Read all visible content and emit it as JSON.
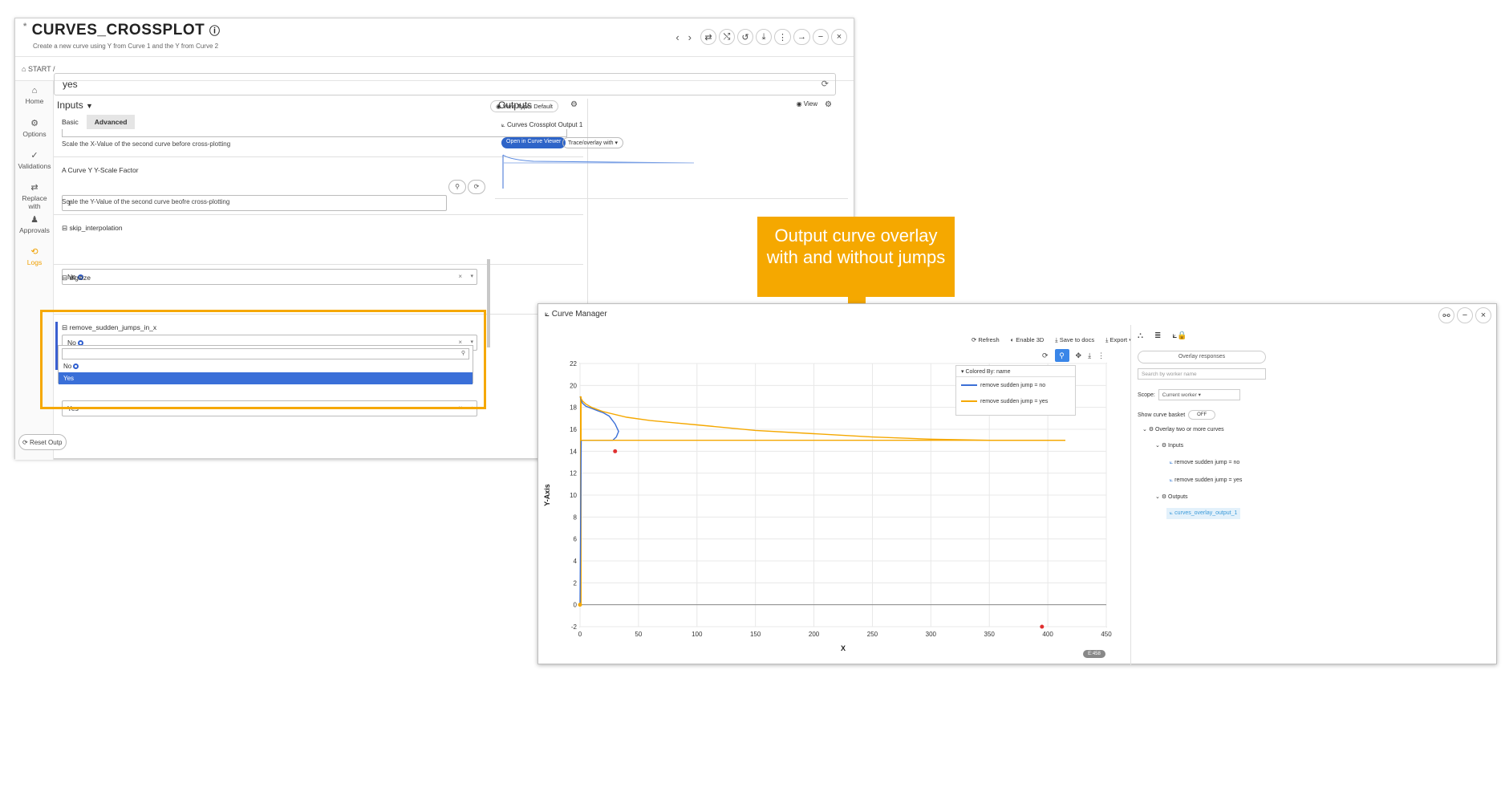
{
  "app": {
    "title": "CURVES_CROSSPLOT",
    "subtitle": "Create a new curve using Y from Curve 1 and the Y from Curve 2",
    "breadcrumb": "START",
    "top_input": "yes"
  },
  "sidebar": {
    "items": [
      {
        "label": "Home",
        "icon": "⌂"
      },
      {
        "label": "Options",
        "icon": "⚙"
      },
      {
        "label": "Validations",
        "icon": "✓"
      },
      {
        "label": "Replace with",
        "icon": "⇄"
      },
      {
        "label": "Approvals",
        "icon": "♟"
      },
      {
        "label": "Logs",
        "icon": "⟲"
      }
    ]
  },
  "inputs": {
    "title": "Inputs",
    "view_type": "View Type: Default",
    "tabs": [
      "Basic",
      "Advanced"
    ],
    "x_scale_help": "Scale the X-Value of the second curve before cross-plotting",
    "y_scale_label": "A  Curve Y Y-Scale Factor",
    "y_scale_value": "1",
    "y_scale_help": "Scale the Y-Value of the second curve beofre cross-plotting",
    "skip_label": "skip_interpolation",
    "skip_value": "No",
    "digitize_label": "digitize",
    "digitize_value": "No",
    "jumps_label": "remove_sudden_jumps_in_x",
    "jumps_value": "Yes",
    "options": [
      "No",
      "Yes"
    ],
    "reset_label": "Reset Outp"
  },
  "outputs": {
    "title": "Outputs",
    "view": "View",
    "item": "Curves Crossplot Output 1",
    "open_btn": "Open in Curve Viewer",
    "trace_btn": "Trace/overlay with ▾"
  },
  "callout": {
    "text": "Output curve overlay with and without jumps"
  },
  "curve_manager": {
    "title": "Curve Manager",
    "toolbar": [
      "Refresh",
      "Enable 3D",
      "Save to docs",
      "Export ▾"
    ],
    "legend_title": "Colored By: name",
    "legend_items": [
      {
        "label": "remove sudden jump = no",
        "color": "#3b6fd6"
      },
      {
        "label": "remove sudden jump = yes",
        "color": "#f5a800"
      }
    ],
    "badge": "E:458"
  },
  "right_panel": {
    "overlay_btn": "Overlay responses",
    "search_placeholder": "Search by worker name",
    "scope_label": "Scope:",
    "scope_value": "Current worker",
    "basket_label": "Show curve basket",
    "basket_toggle": "OFF",
    "tree": {
      "root": "Overlay two or more curves",
      "inputs": "Inputs",
      "input_items": [
        "remove sudden jump = no",
        "remove sudden jump = yes"
      ],
      "outputs": "Outputs",
      "output_item": "curves_overlay_output_1"
    }
  },
  "chart_data": {
    "type": "line",
    "title": "",
    "xlabel": "X",
    "ylabel": "Y-Axis",
    "xlim": [
      0,
      450
    ],
    "ylim": [
      -2,
      22
    ],
    "x_ticks": [
      0,
      50,
      100,
      150,
      200,
      250,
      300,
      350,
      400,
      450
    ],
    "y_ticks": [
      -2,
      0,
      2,
      4,
      6,
      8,
      10,
      12,
      14,
      16,
      18,
      20,
      22
    ],
    "grid": true,
    "series": [
      {
        "name": "remove sudden jump = no",
        "color": "#3b6fd6",
        "x": [
          0,
          2,
          5,
          10,
          15,
          20,
          25,
          30,
          33,
          31,
          28,
          5,
          1,
          0
        ],
        "y": [
          19.0,
          18.4,
          18.1,
          17.9,
          17.7,
          17.5,
          17.2,
          16.5,
          15.8,
          15.3,
          15.0,
          15.0,
          15.0,
          0.0
        ]
      },
      {
        "name": "remove sudden jump = yes",
        "color": "#f5a800",
        "x": [
          0,
          2,
          5,
          10,
          20,
          40,
          60,
          80,
          100,
          150,
          200,
          250,
          300,
          350,
          400,
          415
        ],
        "y": [
          19.0,
          18.6,
          18.3,
          18.0,
          17.6,
          17.1,
          16.8,
          16.6,
          16.4,
          15.9,
          15.6,
          15.3,
          15.1,
          15.0,
          15.0,
          15.0
        ]
      },
      {
        "name": "",
        "color": "#f5a800",
        "x": [
          0,
          415
        ],
        "y": [
          15.0,
          15.0
        ]
      }
    ],
    "markers": [
      {
        "x": 30,
        "y": 14.0,
        "color": "#e03030"
      },
      {
        "x": 395,
        "y": -2.0,
        "color": "#e03030"
      },
      {
        "x": 0,
        "y": 0.0,
        "color": "#f5a800"
      }
    ]
  }
}
